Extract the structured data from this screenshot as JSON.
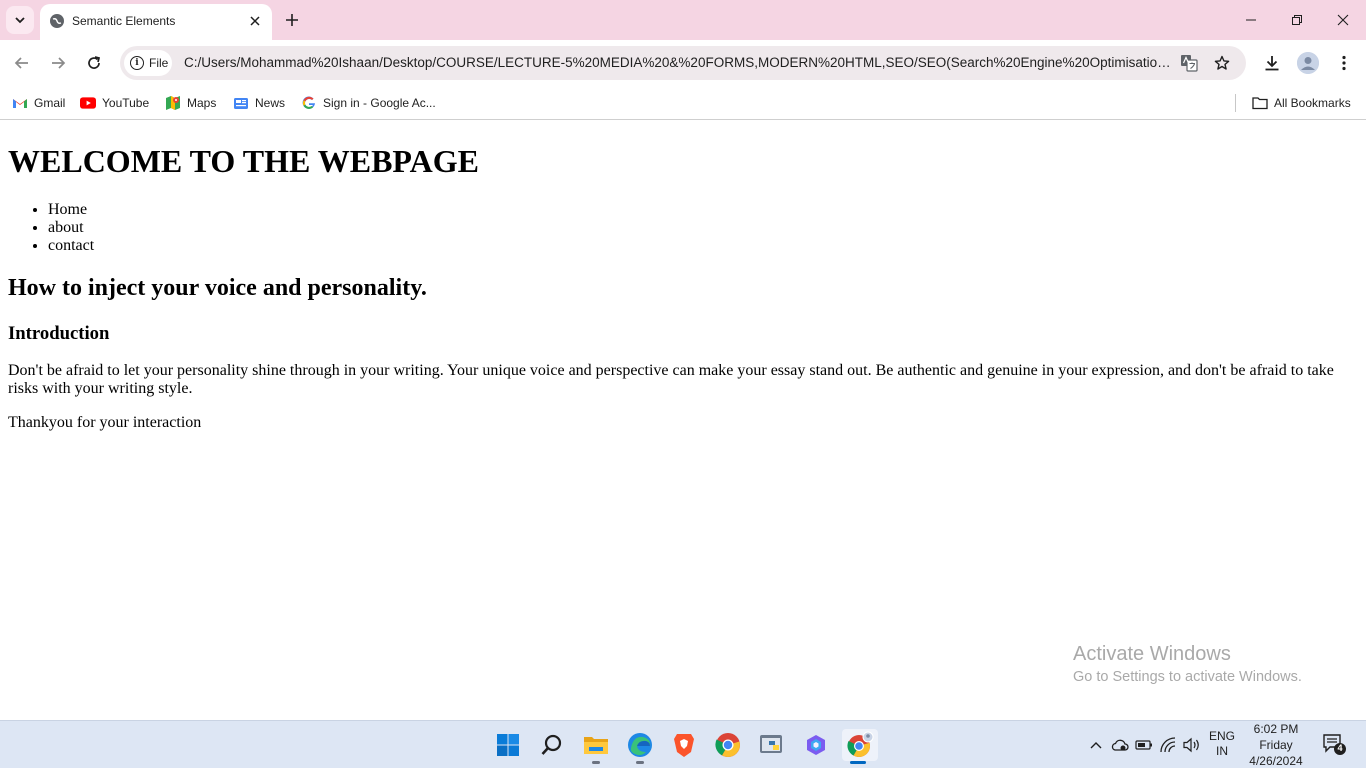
{
  "browser": {
    "tab": {
      "title": "Semantic Elements"
    },
    "omnibox": {
      "scheme_label": "File",
      "url": "C:/Users/Mohammad%20Ishaan/Desktop/COURSE/LECTURE-5%20MEDIA%20&%20FORMS,MODERN%20HTML,SEO/SEO(Search%20Engine%20Optimisation)/..."
    },
    "bookmarks": [
      {
        "label": "Gmail",
        "icon": "gmail-icon"
      },
      {
        "label": "YouTube",
        "icon": "youtube-icon"
      },
      {
        "label": "Maps",
        "icon": "maps-icon"
      },
      {
        "label": "News",
        "icon": "news-icon"
      },
      {
        "label": "Sign in - Google Ac...",
        "icon": "google-icon"
      }
    ],
    "all_bookmarks_label": "All Bookmarks",
    "colors": {
      "tabstrip": "#f5d5e3",
      "omnibox": "#efe9ec"
    }
  },
  "page": {
    "heading": "WELCOME TO THE WEBPAGE",
    "nav": [
      "Home",
      "about",
      "contact"
    ],
    "article_title": "How to inject your voice and personality.",
    "section_title": "Introduction",
    "paragraph": "Don't be afraid to let your personality shine through in your writing. Your unique voice and perspective can make your essay stand out. Be authentic and genuine in your expression, and don't be afraid to take risks with your writing style.",
    "closing": "Thankyou for your interaction"
  },
  "watermark": {
    "title": "Activate Windows",
    "subtitle": "Go to Settings to activate Windows."
  },
  "taskbar": {
    "apps": [
      "start-icon",
      "search-icon",
      "file-explorer-icon",
      "edge-icon",
      "brave-icon",
      "chrome-icon",
      "python-idle-icon",
      "copilot-icon",
      "chrome-profile-icon"
    ],
    "language": {
      "line1": "ENG",
      "line2": "IN"
    },
    "clock": {
      "time": "6:02 PM",
      "day": "Friday",
      "date": "4/26/2024"
    },
    "notification_count": "4"
  }
}
